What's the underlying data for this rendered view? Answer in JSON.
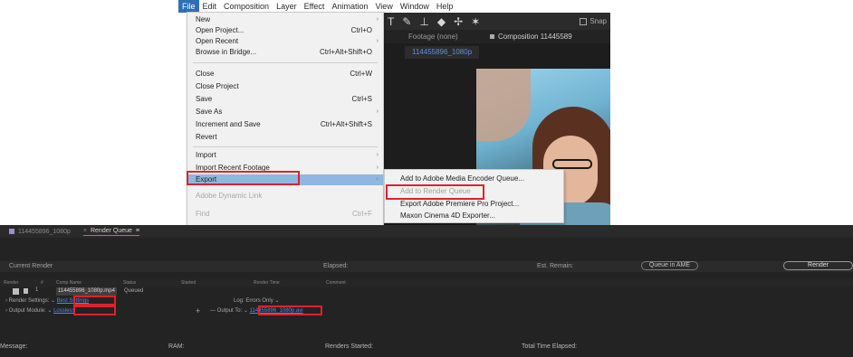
{
  "menubar": {
    "items": [
      "File",
      "Edit",
      "Composition",
      "Layer",
      "Effect",
      "Animation",
      "View",
      "Window",
      "Help"
    ]
  },
  "file_menu": {
    "items": [
      {
        "label": "New",
        "shortcut": "",
        "submenu": true
      },
      {
        "label": "Open Project...",
        "shortcut": "Ctrl+O"
      },
      {
        "label": "Open Recent",
        "shortcut": "",
        "submenu": true
      },
      {
        "label": "Browse in Bridge...",
        "shortcut": "Ctrl+Alt+Shift+O"
      },
      {
        "label": "Close",
        "shortcut": "Ctrl+W"
      },
      {
        "label": "Close Project",
        "shortcut": ""
      },
      {
        "label": "Save",
        "shortcut": "Ctrl+S"
      },
      {
        "label": "Save As",
        "shortcut": "",
        "submenu": true
      },
      {
        "label": "Increment and Save",
        "shortcut": "Ctrl+Alt+Shift+S"
      },
      {
        "label": "Revert",
        "shortcut": ""
      },
      {
        "label": "Import",
        "shortcut": "",
        "submenu": true
      },
      {
        "label": "Import Recent Footage",
        "shortcut": "",
        "submenu": true
      },
      {
        "label": "Export",
        "shortcut": "",
        "submenu": true,
        "highlighted": true
      },
      {
        "label": "Adobe Dynamic Link",
        "shortcut": "",
        "disabled": true
      },
      {
        "label": "Find",
        "shortcut": "Ctrl+F",
        "disabled": true
      }
    ]
  },
  "export_submenu": {
    "items": [
      {
        "label": "Add to Adobe Media Encoder Queue..."
      },
      {
        "label": "Add to Render Queue",
        "disabled": true
      },
      {
        "label": "Export Adobe Premiere Pro Project..."
      },
      {
        "label": "Maxon Cinema 4D Exporter..."
      }
    ]
  },
  "app": {
    "snap_label": "Snap",
    "footage_tab": "Footage (none)",
    "comp_tab": "Composition 11445589",
    "comp_name_tab": "114455896_1080p"
  },
  "render_queue": {
    "tab_comp": "114455896_1080p",
    "tab_rq": "Render Queue",
    "current_render": "Current Render",
    "elapsed": "Elapsed:",
    "est_remain": "Est. Remain:",
    "queue_ame": "Queue in AME",
    "render_button": "Render",
    "headers": [
      "Render",
      "#",
      "Comp Name",
      "Status",
      "Started",
      "Render Time",
      "Comment"
    ],
    "item": {
      "number": "1",
      "comp_name": "114455896_1080p.mp4",
      "status": "Queued",
      "render_settings_label": "Render Settings:",
      "render_settings_value": "Best Settings",
      "output_module_label": "Output Module:",
      "output_module_value": "Lossless",
      "log_label": "Log:",
      "log_value": "Errors Only",
      "output_to_label": "Output To:",
      "output_to_value": "114455896_1080p.avi"
    },
    "status_bar": {
      "message": "Message:",
      "ram": "RAM:",
      "renders_started": "Renders Started:",
      "total_time_elapsed": "Total Time Elapsed:"
    }
  },
  "colors": {
    "highlight_row": "#8fb7e1",
    "callout_red": "#e0212b",
    "link_blue": "#5789ec",
    "panel_dark": "#232323"
  }
}
